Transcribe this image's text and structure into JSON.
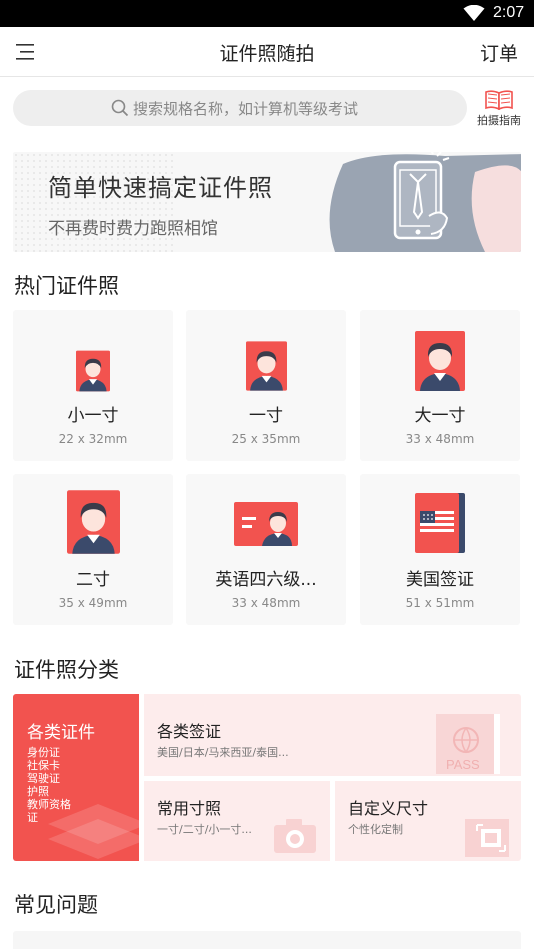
{
  "status": {
    "time": "2:07"
  },
  "appbar": {
    "title": "证件照随拍",
    "orders": "订单"
  },
  "search": {
    "placeholder": "搜索规格名称，如计算机等级考试",
    "guide_label": "拍摄指南"
  },
  "banner": {
    "headline": "简单快速搞定证件照",
    "subline": "不再费时费力跑照相馆"
  },
  "hot": {
    "title": "热门证件照",
    "items": [
      {
        "name": "小一寸",
        "size": "22 x 32mm"
      },
      {
        "name": "一寸",
        "size": "25 x 35mm"
      },
      {
        "name": "大一寸",
        "size": "33 x 48mm"
      },
      {
        "name": "二寸",
        "size": "35 x 49mm"
      },
      {
        "name": "英语四六级...",
        "size": "33 x 48mm"
      },
      {
        "name": "美国签证",
        "size": "51 x 51mm"
      }
    ]
  },
  "categories": {
    "title": "证件照分类",
    "main": {
      "title": "各类证件",
      "items": "身份证\n社保卡\n驾驶证\n护照\n教师资格证"
    },
    "visa": {
      "title": "各类签证",
      "sub": "美国/日本/马来西亚/泰国..."
    },
    "common": {
      "title": "常用寸照",
      "sub": "一寸/二寸/小一寸..."
    },
    "custom": {
      "title": "自定义尺寸",
      "sub": "个性化定制"
    },
    "passport_stamp": "PASS"
  },
  "faq": {
    "title": "常见问题"
  },
  "colors": {
    "accent": "#f2534f",
    "portrait_bg": "#f2534f",
    "shirt": "#3b4a6b"
  }
}
